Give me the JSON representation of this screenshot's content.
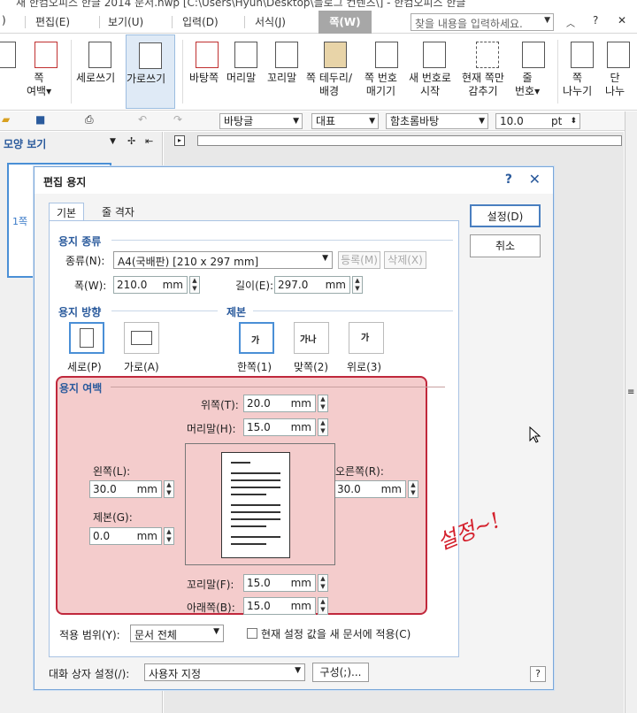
{
  "window": {
    "title": "새 한컴오피스 한글 2014 문서.hwp [C:\\Users\\Hyun\\Desktop\\블로그 컨텐츠\\] - 한컴오피스 한글"
  },
  "menu": {
    "items": [
      "편집(E)",
      "보기(U)",
      "입력(D)",
      "서식(J)"
    ],
    "active": "쪽(W)",
    "search_placeholder": "찾을 내용을 입력하세요.",
    "help": "?"
  },
  "ribbon": {
    "buttons": [
      "쪽\n여백▾",
      "세로쓰기",
      "가로쓰기",
      "바탕쪽",
      "머리말",
      "꼬리말",
      "쪽 테두리/\n배경",
      "쪽 번호\n매기기",
      "새 번호로\n시작",
      "현재 쪽만\n감추기",
      "줄\n번호▾",
      "쪽\n나누기",
      "단\n나누"
    ]
  },
  "toolbar": {
    "style": "바탕글",
    "lang": "대표",
    "font": "함초롬바탕",
    "size": "10.0",
    "unit": "pt"
  },
  "left_pane": {
    "title": "모양 보기",
    "page_label": "1쪽"
  },
  "dialog": {
    "title": "편집 용지",
    "help": "?",
    "close": "✕",
    "tabs": [
      "기본",
      "줄 격자"
    ],
    "paper_kind": {
      "title": "용지 종류",
      "kind_label": "종류(N):",
      "kind_value": "A4(국배판)  [210 x 297 mm]",
      "register": "등록(M)",
      "delete": "삭제(X)",
      "width_label": "폭(W):",
      "width_value": "210.0",
      "height_label": "길이(E):",
      "height_value": "297.0",
      "unit": "mm"
    },
    "orientation": {
      "title": "용지 방향",
      "portrait": "세로(P)",
      "landscape": "가로(A)"
    },
    "binding": {
      "title": "제본",
      "one_side": "한쪽(1)",
      "facing": "맞쪽(2)",
      "top": "위로(3)"
    },
    "margins": {
      "title": "용지 여백",
      "top_label": "위쪽(T):",
      "top_value": "20.0",
      "header_label": "머리말(H):",
      "header_value": "15.0",
      "left_label": "왼쪽(L):",
      "left_value": "30.0",
      "right_label": "오른쪽(R):",
      "right_value": "30.0",
      "gutter_label": "제본(G):",
      "gutter_value": "0.0",
      "footer_label": "꼬리말(F):",
      "footer_value": "15.0",
      "bottom_label": "아래쪽(B):",
      "bottom_value": "15.0",
      "unit": "mm"
    },
    "apply_label": "적용 범위(Y):",
    "apply_value": "문서 전체",
    "default_check": "현재 설정 값을 새 문서에 적용(C)",
    "ok": "설정(D)",
    "cancel": "취소",
    "dialog_setting_label": "대화 상자 설정(/):",
    "dialog_setting_value": "사용자 지정",
    "compose": "구성(;)...",
    "help_bottom": "?"
  },
  "annotation": "설정~!"
}
